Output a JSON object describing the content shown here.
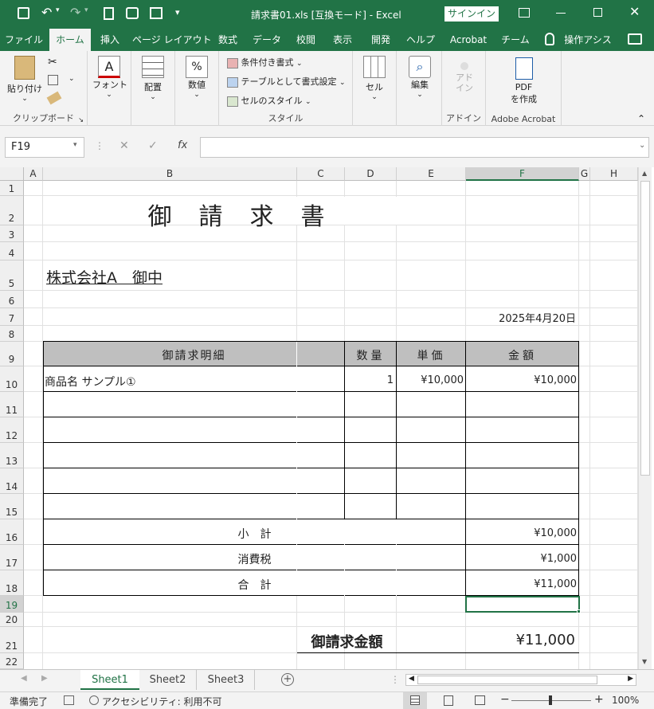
{
  "titlebar": {
    "title": "請求書01.xls  [互換モード]  -  Excel",
    "signin": "サインイン",
    "qa_more": "▾"
  },
  "menu": {
    "tabs": [
      "ファイル",
      "ホーム",
      "挿入",
      "ページ レイアウト",
      "数式",
      "データ",
      "校閲",
      "表示",
      "開発",
      "ヘルプ",
      "Acrobat",
      "チーム",
      "操作アシス"
    ]
  },
  "ribbon": {
    "paste": "貼り付け",
    "clipboard": "クリップボード",
    "font": "フォント",
    "alignment": "配置",
    "number": "数値",
    "number_symbol": "%",
    "cond_format": "条件付き書式",
    "table_format": "テーブルとして書式設定",
    "cell_styles": "セルのスタイル",
    "styles": "スタイル",
    "cells": "セル",
    "editing": "編集",
    "addin_btn": "アド\nイン",
    "addin_group": "アドイン",
    "pdf_btn1": "PDF",
    "pdf_btn2": "を作成",
    "acrobat_group": "Adobe Acrobat"
  },
  "formula_bar": {
    "name_box": "F19",
    "formula": ""
  },
  "columns": [
    "A",
    "B",
    "C",
    "D",
    "E",
    "F",
    "G",
    "H"
  ],
  "rows": [
    "1",
    "2",
    "3",
    "4",
    "5",
    "6",
    "7",
    "8",
    "9",
    "10",
    "11",
    "12",
    "13",
    "14",
    "15",
    "16",
    "17",
    "18",
    "19",
    "20",
    "21",
    "22"
  ],
  "sheet": {
    "title": "御　請　求　書",
    "addressee": "株式会社A　御中",
    "date": "2025年4月20日",
    "header": {
      "desc": "御請求明細",
      "qty": "数量",
      "unit": "単価",
      "amount": "金額"
    },
    "items": [
      {
        "name": "商品名  サンプル①",
        "qty": "1",
        "unit": "¥10,000",
        "amount": "¥10,000"
      }
    ],
    "subtotal_label": "小　計",
    "subtotal": "¥10,000",
    "tax_label": "消費税",
    "tax": "¥1,000",
    "total_label": "合　計",
    "total": "¥11,000",
    "grand_label": "御請求金額",
    "grand_total": "¥11,000"
  },
  "sheets": {
    "tabs": [
      "Sheet1",
      "Sheet2",
      "Sheet3"
    ],
    "active": "Sheet1"
  },
  "status": {
    "ready": "準備完了",
    "accessibility": "アクセシビリティ: 利用不可",
    "zoom": "100%"
  },
  "colors": {
    "accent": "#217346",
    "header_fill": "#bfbfbf"
  }
}
